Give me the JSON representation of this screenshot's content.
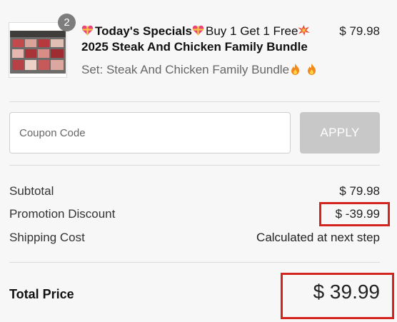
{
  "item": {
    "quantity": "2",
    "title_bold": "Today's Specials",
    "title_rest_line1": "Buy 1 Get 1 Free",
    "title_line2": "2025 Steak And Chicken Family Bundle",
    "variant": "Set: Steak And Chicken Family Bundle",
    "price": "$ 79.98",
    "icons": [
      "gift-heart-icon",
      "gift-heart-icon",
      "collision-icon",
      "fire-icon",
      "fire-icon"
    ]
  },
  "coupon": {
    "placeholder": "Coupon Code",
    "apply_label": "APPLY"
  },
  "summary": {
    "subtotal_label": "Subtotal",
    "subtotal_value": "$ 79.98",
    "discount_label": "Promotion Discount",
    "discount_value": "$ -39.99",
    "shipping_label": "Shipping Cost",
    "shipping_value": "Calculated at next step",
    "total_label": "Total Price",
    "total_value": "$ 39.99"
  },
  "colors": {
    "highlight": "#d4241e",
    "apply_disabled": "#c8c8c8",
    "badge": "#7d7d7d"
  }
}
